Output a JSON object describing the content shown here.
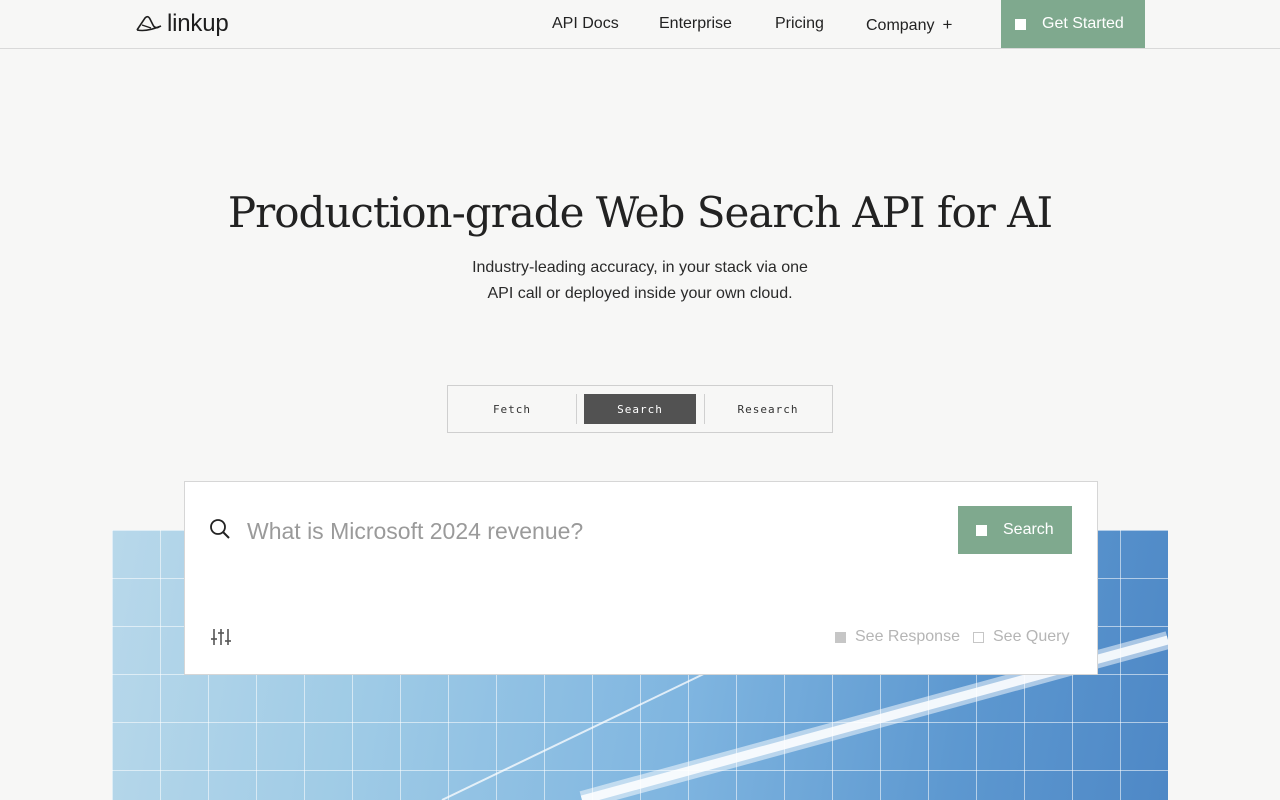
{
  "header": {
    "logo_text": "linkup",
    "nav": [
      "API Docs",
      "Enterprise",
      "Pricing",
      "Company"
    ],
    "company_expand": "+",
    "cta_label": "Get Started"
  },
  "hero": {
    "title": "Production-grade Web Search API for AI",
    "subtitle_line1": "Industry-leading accuracy, in your stack via one",
    "subtitle_line2": "API call or deployed inside your own cloud."
  },
  "tabs": {
    "items": [
      "Fetch",
      "Search",
      "Research"
    ],
    "active": "Search"
  },
  "search": {
    "placeholder": "What is Microsoft 2024 revenue?",
    "button_label": "Search",
    "options": [
      {
        "label": "See Response",
        "checked": true
      },
      {
        "label": "See Query",
        "checked": false
      }
    ],
    "icons": [
      "search-icon",
      "sliders-icon"
    ]
  },
  "colors": {
    "accent": "#7fa98e",
    "active_tab": "#525252",
    "background": "#f7f7f6"
  }
}
